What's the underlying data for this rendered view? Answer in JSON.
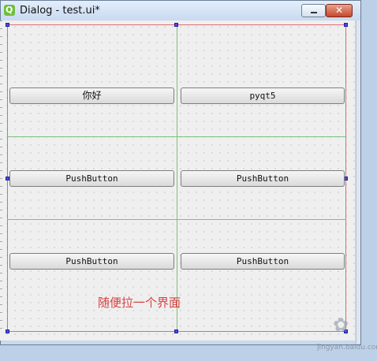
{
  "window": {
    "title": "Dialog - test.ui*",
    "close_glyph": "✕",
    "app_icon": "qt-designer-icon"
  },
  "buttons": {
    "r1c1": "你好",
    "r1c2": "pyqt5",
    "r2c1": "PushButton",
    "r2c2": "PushButton",
    "r3c1": "PushButton",
    "r3c2": "PushButton"
  },
  "annotation": "随便拉一个界面",
  "watermark": {
    "url": "jingyan.baidu.com"
  }
}
